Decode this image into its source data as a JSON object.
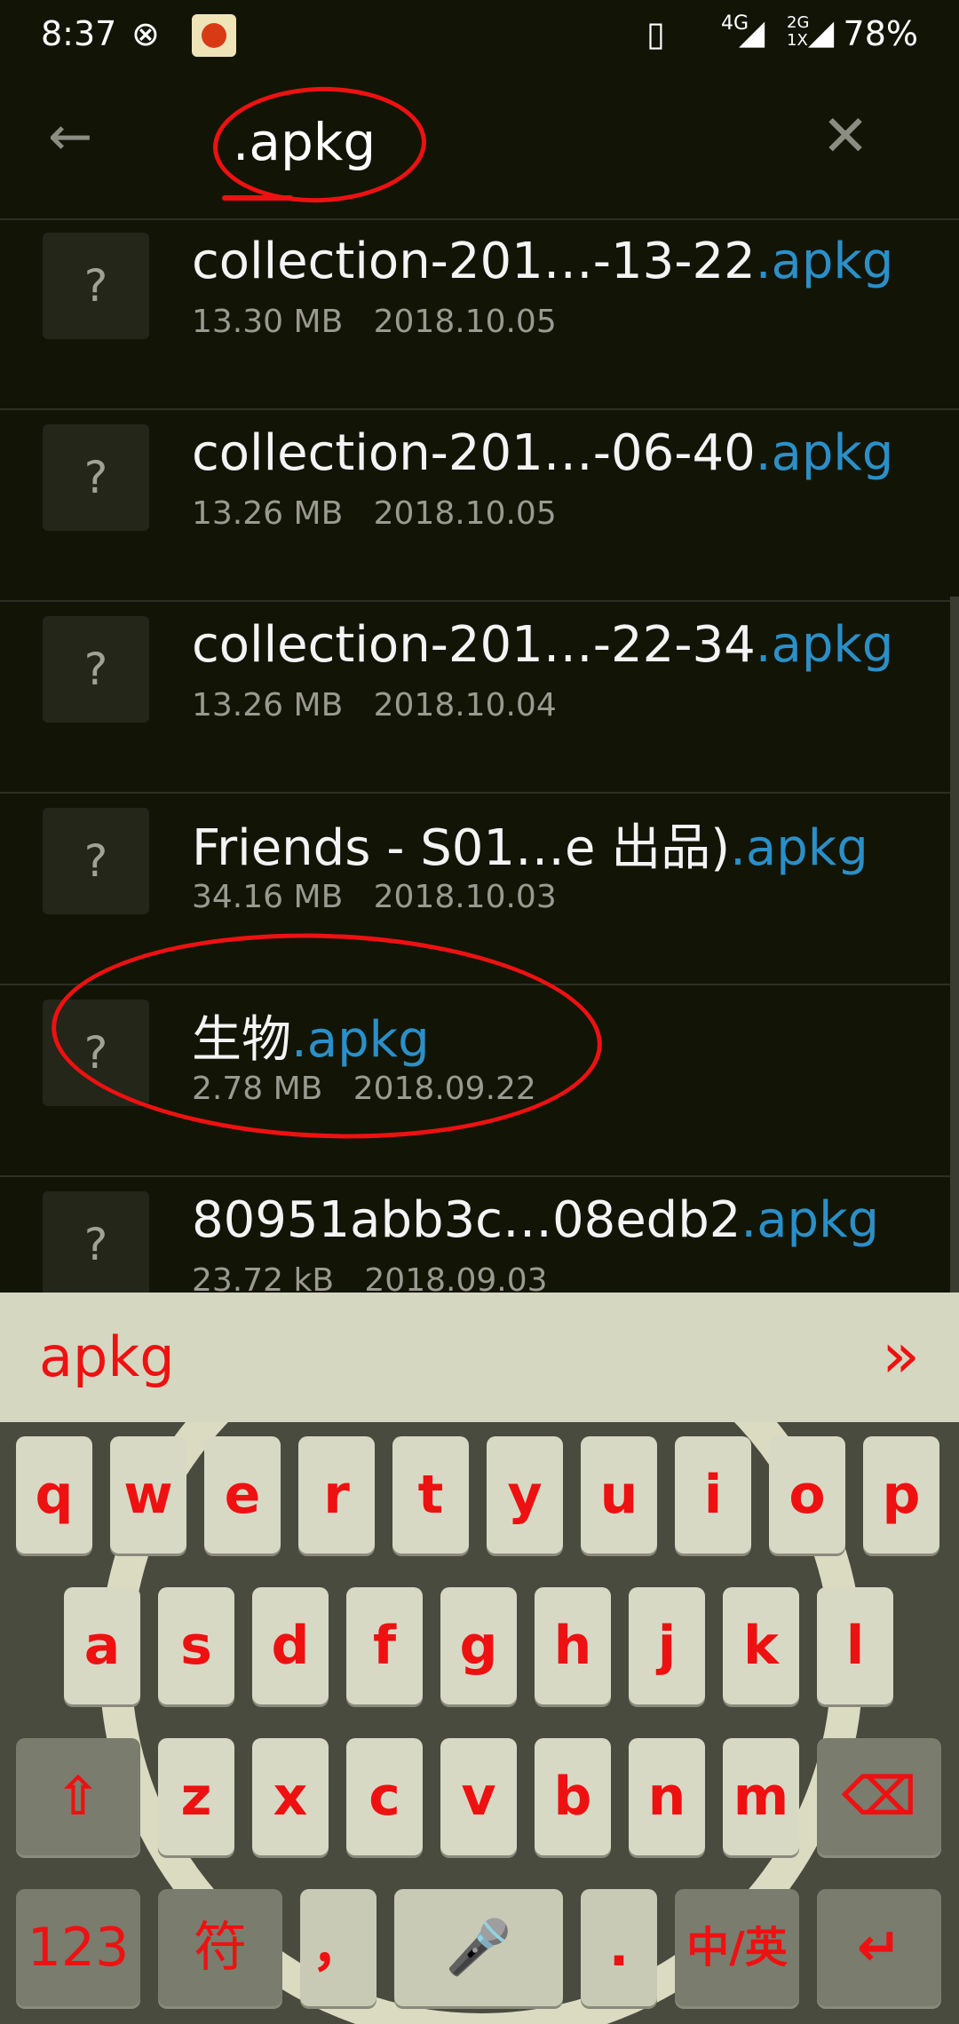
{
  "status_bar": {
    "time": "8:37",
    "network_label": "4G",
    "network_label2": "2G 1X",
    "battery": "78%"
  },
  "search": {
    "query": ".apkg",
    "back_icon": "arrow-left-icon",
    "clear_icon": "close-icon"
  },
  "files": [
    {
      "name_main": "collection-201…-13-22",
      "ext": ".apkg",
      "size": "13.30 MB",
      "date": "2018.10.05",
      "icon": "unknown-file-icon"
    },
    {
      "name_main": "collection-201…-06-40",
      "ext": ".apkg",
      "size": "13.26 MB",
      "date": "2018.10.05",
      "icon": "unknown-file-icon"
    },
    {
      "name_main": "collection-201…-22-34",
      "ext": ".apkg",
      "size": "13.26 MB",
      "date": "2018.10.04",
      "icon": "unknown-file-icon"
    },
    {
      "name_main": "Friends -  S01…e 出品)",
      "ext": ".apkg",
      "size": "34.16 MB",
      "date": "2018.10.03",
      "icon": "unknown-file-icon"
    },
    {
      "name_main": "生物",
      "ext": ".apkg",
      "size": "2.78 MB",
      "date": "2018.09.22",
      "icon": "unknown-file-icon"
    },
    {
      "name_main": "80951abb3c…08edb2",
      "ext": ".apkg",
      "size": "23.72 kB",
      "date": "2018.09.03",
      "icon": "unknown-file-icon"
    }
  ],
  "keyboard": {
    "suggestion": "apkg",
    "expand_icon": "double-chevron-right-icon",
    "row1": [
      "q",
      "w",
      "e",
      "r",
      "t",
      "y",
      "u",
      "i",
      "o",
      "p"
    ],
    "row2": [
      "a",
      "s",
      "d",
      "f",
      "g",
      "h",
      "j",
      "k",
      "l"
    ],
    "row3": [
      "z",
      "x",
      "c",
      "v",
      "b",
      "n",
      "m"
    ],
    "shift_icon": "shift-icon",
    "backspace_icon": "backspace-icon",
    "numbers_label": "123",
    "symbols_label": "符",
    "comma_label": "，",
    "space_icon": "microphone-space-icon",
    "period_label": ".",
    "lang_label": "中/英",
    "enter_icon": "enter-icon"
  },
  "colors": {
    "background": "#121506",
    "accent_ext": "#2b8fc8",
    "annotation": "#e11111",
    "key_text": "#e11111"
  }
}
